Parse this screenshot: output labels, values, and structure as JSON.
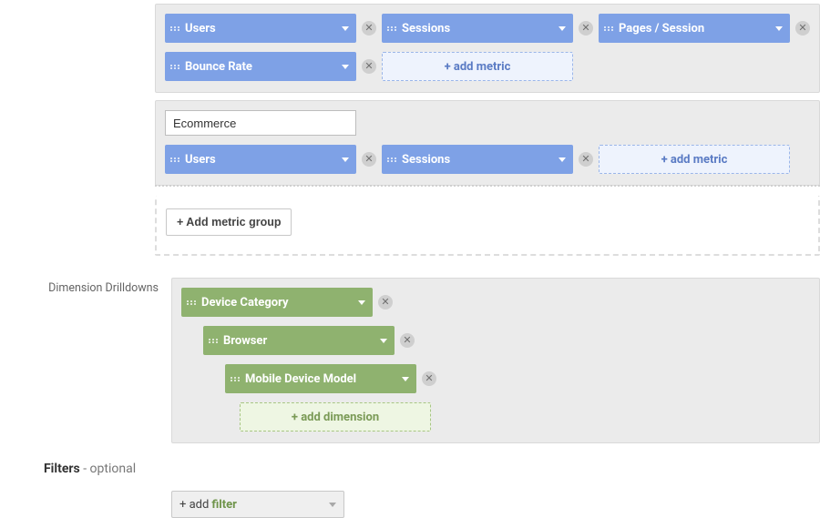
{
  "metricGroups": {
    "group1": {
      "chips": [
        "Users",
        "Sessions",
        "Pages / Session",
        "Bounce Rate"
      ],
      "add": "+ add metric"
    },
    "group2": {
      "name": "Ecommerce",
      "chips": [
        "Users",
        "Sessions"
      ],
      "add": "+ add metric"
    },
    "addGroupBtn": "+ Add metric group"
  },
  "dimensions": {
    "label": "Dimension Drilldowns",
    "chips": [
      "Device Category",
      "Browser",
      "Mobile Device Model"
    ],
    "add": "+ add dimension"
  },
  "filters": {
    "heading": "Filters",
    "optional": " - optional",
    "add_prefix": "+ add",
    "add_keyword": "filter"
  }
}
